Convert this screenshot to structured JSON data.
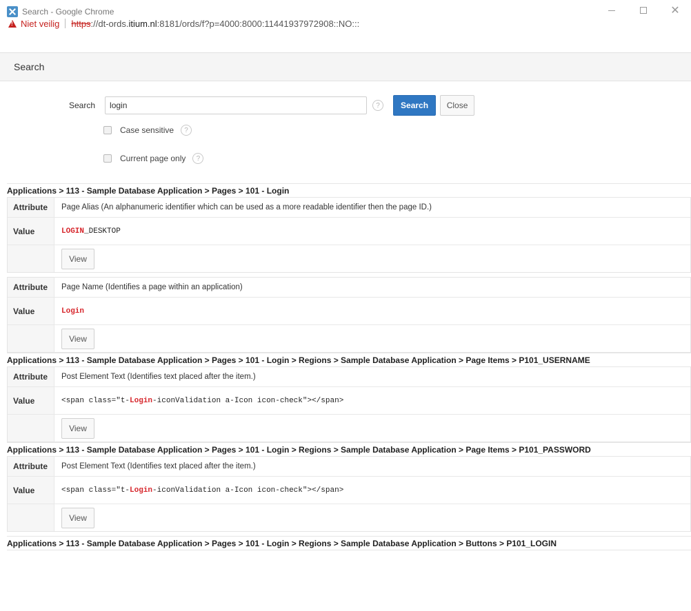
{
  "window": {
    "title": "Search - Google Chrome",
    "security_label": "Niet veilig",
    "url_scheme": "https",
    "url_host_prefix": "://dt-ords.",
    "url_host": "itium.nl",
    "url_rest": ":8181/ords/f?p=4000:8000:11441937972908::NO:::"
  },
  "dialog": {
    "title": "Search"
  },
  "search": {
    "label": "Search",
    "value": "login",
    "help": "?",
    "search_button": "Search",
    "close_button": "Close",
    "case_sensitive_label": "Case sensitive",
    "current_page_only_label": "Current page only"
  },
  "labels": {
    "attribute": "Attribute",
    "value": "Value",
    "view": "View"
  },
  "results": {
    "bc1": "Applications > 113 - Sample Database Application > Pages > 101 - Login",
    "r1a_attr": "Page Alias (An alphanumeric identifier which can be used as a more readable identifier then the page ID.)",
    "r1a_hl": "LOGIN",
    "r1a_rest": "_DESKTOP",
    "r1b_attr": "Page Name (Identifies a page within an application)",
    "r1b_hl": "Login",
    "bc2": "Applications > 113 - Sample Database Application > Pages > 101 - Login > Regions > Sample Database Application > Page Items > P101_USERNAME",
    "r2_attr": "Post Element Text (Identifies text placed after the item.)",
    "r2_pre": "<span class=\"t-",
    "r2_hl": "Login",
    "r2_post": "-iconValidation a-Icon icon-check\"></span>",
    "bc3": "Applications > 113 - Sample Database Application > Pages > 101 - Login > Regions > Sample Database Application > Page Items > P101_PASSWORD",
    "r3_attr": "Post Element Text (Identifies text placed after the item.)",
    "r3_pre": "<span class=\"t-",
    "r3_hl": "Login",
    "r3_post": "-iconValidation a-Icon icon-check\"></span>",
    "bc4": "Applications > 113 - Sample Database Application > Pages > 101 - Login > Regions > Sample Database Application > Buttons > P101_LOGIN"
  }
}
